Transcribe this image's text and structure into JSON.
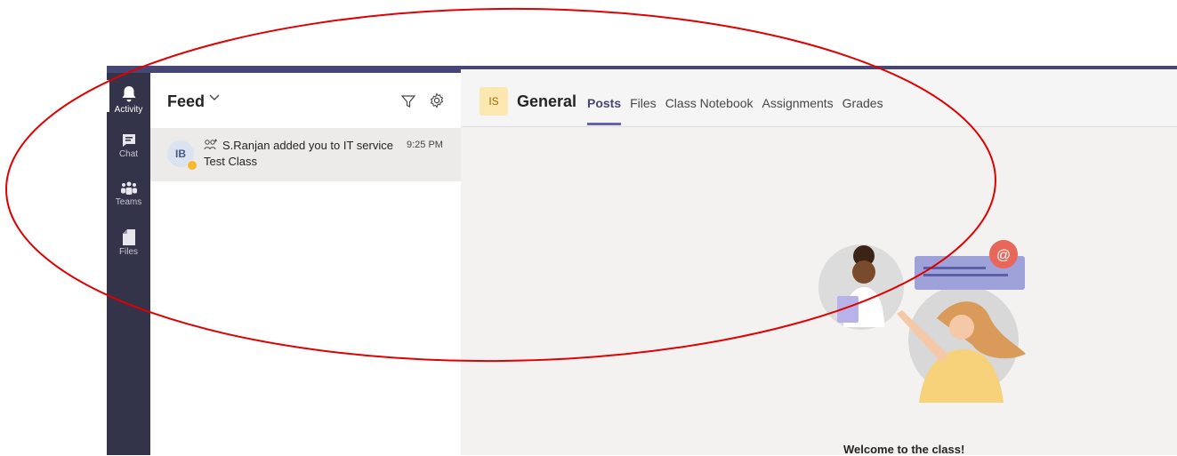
{
  "rail": {
    "items": [
      {
        "label": "Activity",
        "icon": "bell-icon"
      },
      {
        "label": "Chat",
        "icon": "chat-icon"
      },
      {
        "label": "Teams",
        "icon": "teams-icon"
      },
      {
        "label": "Files",
        "icon": "file-icon"
      }
    ]
  },
  "feed": {
    "title": "Feed",
    "items": [
      {
        "avatar": "IB",
        "text": "S.Ranjan added you to IT service",
        "time": "9:25 PM",
        "subtitle": "Test Class"
      }
    ]
  },
  "channel": {
    "team_avatar": "IS",
    "name": "General",
    "tabs": [
      "Posts",
      "Files",
      "Class Notebook",
      "Assignments",
      "Grades"
    ]
  },
  "welcome": "Welcome to the class!",
  "colors": {
    "rail": "#33344a",
    "accent": "#6264a7",
    "annotation": "#e00000"
  }
}
